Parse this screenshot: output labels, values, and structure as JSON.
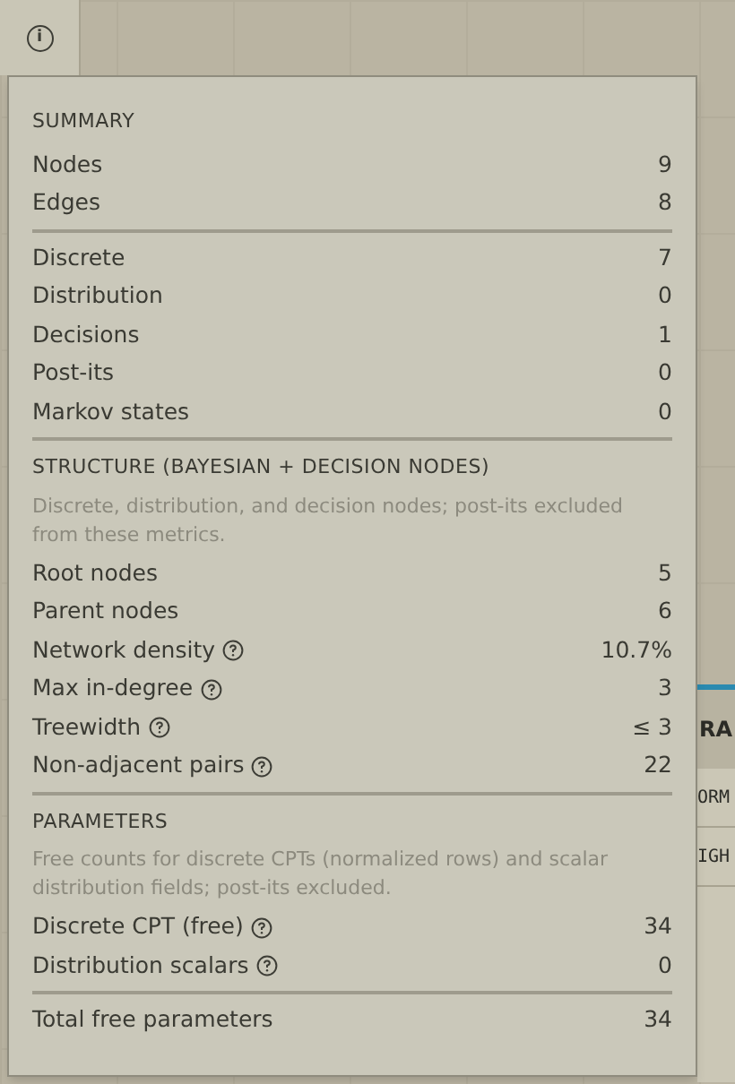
{
  "info_button": {
    "symbol": "i"
  },
  "background_card": {
    "title": "RA",
    "rows": [
      "ORM",
      "IGH"
    ]
  },
  "panel": {
    "sections": [
      {
        "heading": "SUMMARY",
        "rows": [
          {
            "label": "Nodes",
            "value": "9",
            "help": false
          },
          {
            "label": "Edges",
            "value": "8",
            "help": false
          }
        ]
      },
      {
        "rows": [
          {
            "label": "Discrete",
            "value": "7",
            "help": false
          },
          {
            "label": "Distribution",
            "value": "0",
            "help": false
          },
          {
            "label": "Decisions",
            "value": "1",
            "help": false
          },
          {
            "label": "Post-its",
            "value": "0",
            "help": false
          },
          {
            "label": "Markov states",
            "value": "0",
            "help": false
          }
        ]
      },
      {
        "heading": "STRUCTURE (BAYESIAN + DECISION NODES)",
        "note": "Discrete, distribution, and decision nodes; post-its excluded from these metrics.",
        "rows": [
          {
            "label": "Root nodes",
            "value": "5",
            "help": false
          },
          {
            "label": "Parent nodes",
            "value": "6",
            "help": false
          },
          {
            "label": "Network density",
            "value": "10.7%",
            "help": true
          },
          {
            "label": "Max in-degree",
            "value": "3",
            "help": true
          },
          {
            "label": "Treewidth",
            "value": "≤ 3",
            "help": true
          },
          {
            "label": "Non-adjacent pairs",
            "value": "22",
            "help": true
          }
        ]
      },
      {
        "heading": "PARAMETERS",
        "note": "Free counts for discrete CPTs (normalized rows) and scalar distribution fields; post-its excluded.",
        "rows": [
          {
            "label": "Discrete CPT (free)",
            "value": "34",
            "help": true
          },
          {
            "label": "Distribution scalars",
            "value": "0",
            "help": true
          }
        ]
      },
      {
        "rows": [
          {
            "label": "Total free parameters",
            "value": "34",
            "help": false
          }
        ]
      }
    ]
  }
}
